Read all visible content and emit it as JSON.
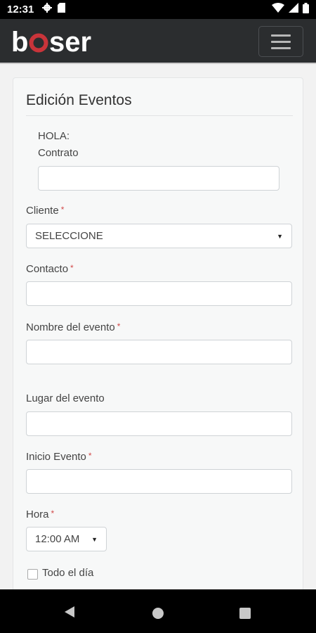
{
  "status_bar": {
    "time": "12:31"
  },
  "app": {
    "logo_text": "boser",
    "menu_label": "Menu"
  },
  "form": {
    "title": "Edición Eventos",
    "greeting": "HOLA:",
    "contrato": {
      "label": "Contrato",
      "value": ""
    },
    "cliente": {
      "label": "Cliente",
      "required": "*",
      "value": "SELECCIONE"
    },
    "contacto": {
      "label": "Contacto",
      "required": "*",
      "value": ""
    },
    "nombre_evento": {
      "label": "Nombre del evento",
      "required": "*",
      "value": ""
    },
    "lugar_evento": {
      "label": "Lugar del evento",
      "value": ""
    },
    "inicio_evento": {
      "label": "Inicio Evento",
      "required": "*",
      "value": ""
    },
    "hora": {
      "label": "Hora",
      "required": "*",
      "value": "12:00 AM"
    },
    "todo_el_dia": {
      "label": "Todo el día",
      "checked": false
    }
  },
  "colors": {
    "accent_red": "#c9343a",
    "navbar_bg": "#2b2d2f",
    "required_red": "#d24a4a"
  }
}
